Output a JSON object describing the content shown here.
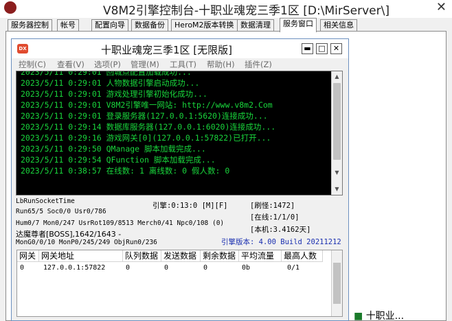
{
  "outer": {
    "title": "V8M2引擎控制台-十职业魂宠三季1区 [D:\\MirServer\\]"
  },
  "tabs": [
    {
      "label": "服务器控制"
    },
    {
      "label": "帐号"
    },
    {
      "label": "配置向导"
    },
    {
      "label": "数据备份"
    },
    {
      "label": "HeroM2版本转换"
    },
    {
      "label": "数据清理"
    },
    {
      "label": "服务窗口"
    },
    {
      "label": "相关信息"
    }
  ],
  "inner": {
    "title": "十职业魂宠三季1区 [无限版]",
    "icon_text": "DX",
    "menu": [
      "控制(C)",
      "查看(V)",
      "选项(P)",
      "管理(M)",
      "工具(T)",
      "帮助(H)",
      "插件(Z)"
    ]
  },
  "console": {
    "lines": [
      "2023/5/11 0:29:01 回城点配置加载成功...",
      "2023/5/11 0:29:01 人物数据引擎启动成功...",
      "2023/5/11 0:29:01 游戏处理引擎初始化成功...",
      "2023/5/11 0:29:01 V8M2引擎唯一网站: http://www.v8m2.Com",
      "2023/5/11 0:29:01 登录服务器(127.0.0.1:5620)连接成功...",
      "2023/5/11 0:29:14 数据库服务器(127.0.0.1:6020)连接成功...",
      "2023/5/11 0:29:16 游戏网关[0](127.0.0.1:57822)已打开...",
      "2023/5/11 0:29:50 QManage 脚本加载完成...",
      "2023/5/11 0:29:54 QFunction 脚本加载完成...",
      "2023/5/11 0:38:57 在线数: 1 离线数: 0 假人数: 0"
    ]
  },
  "stats": {
    "run_socket": "LbRunSocketTime",
    "engine_time": "引擎:0:13:0 [M][F]",
    "refresh": "[刷怪:1472]",
    "run_line": "Run65/5 Soc0/0 Usr0/786",
    "online": "[在线:1/1/0]",
    "hum_line": "Hum0/7 Mon0/247 UsrRot109/8513 Merch0/41 Npc0/108 (0)",
    "local": "[本机:3.4162天]",
    "boss": "达魔尊者[BOSS],1642/1643 -",
    "version": "引擎版本: 4.00 Build 20211212",
    "mon_line": "MonG0/0/10 MonP0/245/249 ObjRun0/236"
  },
  "table": {
    "columns": [
      "网关",
      "网关地址",
      "队列数据",
      "发送数据",
      "剩余数据",
      "平均流量",
      "最高人数"
    ],
    "rows": [
      [
        "0",
        "127.0.0.1:57822",
        "0",
        "0",
        "0",
        "0b",
        "0/1"
      ]
    ]
  },
  "taskbar": {
    "item": "十职业..."
  }
}
